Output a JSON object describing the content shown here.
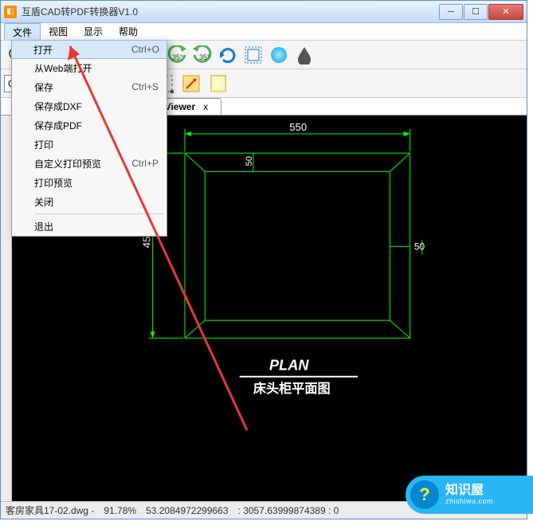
{
  "window": {
    "title": "互盾CAD转PDF转换器V1.0"
  },
  "menubar": {
    "file": "文件",
    "view": "视图",
    "display": "显示",
    "help": "帮助"
  },
  "dropdown": {
    "open": "打开",
    "open_sc": "Ctrl+O",
    "open_web": "从Web端打开",
    "save": "保存",
    "save_sc": "Ctrl+S",
    "save_dxf": "保存成DXF",
    "save_pdf": "保存成PDF",
    "print": "打印",
    "custom_preview": "自定义打印预览",
    "custom_preview_sc": "Ctrl+P",
    "print_preview": "打印预览",
    "close": "关闭",
    "exit": "退出"
  },
  "toolbar": {
    "gdi": "GDI+",
    "rot1": "35°",
    "rot2": "35°"
  },
  "tab": {
    "label": "DViewer",
    "close": "x"
  },
  "cad": {
    "dim_top": "550",
    "dim_left": "450",
    "dim_inner_top": "50",
    "dim_inner_right": "50",
    "plan": "PLAN",
    "plan_cn": "床头柜平面图"
  },
  "status": {
    "file": "客房家具17-02.dwg -",
    "zoom": "91.78%",
    "x": "53.2084972299663",
    "y": ": 3057.63999874389 : 0"
  },
  "watermark": {
    "brand": "知识屋",
    "url": "zhishiwu.com"
  }
}
